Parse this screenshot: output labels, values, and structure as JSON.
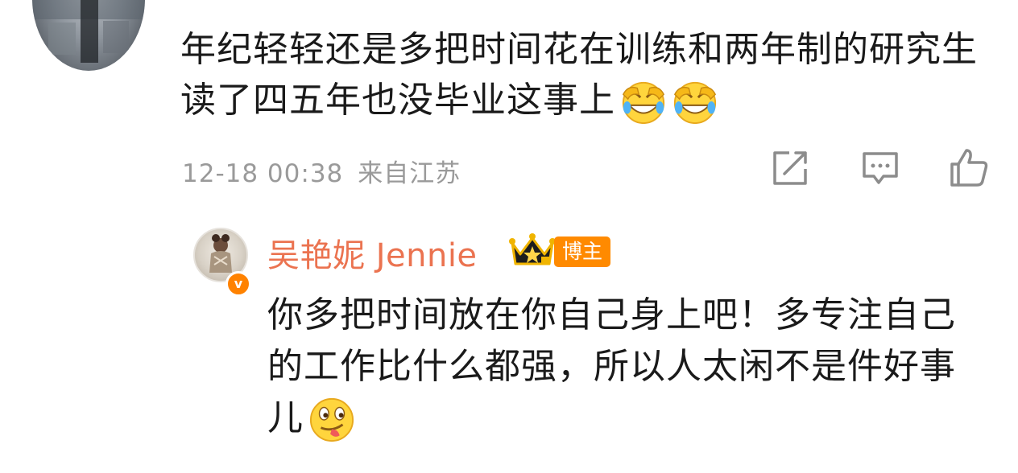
{
  "comment": {
    "text": "年纪轻轻还是多把时间花在训练和两年制的研究生读了四五年也没毕业这事上",
    "emojis": [
      "laugh-cry-icon",
      "laugh-cry-icon"
    ],
    "timestamp": "12-18 00:38",
    "location": "来自江苏",
    "actions": [
      "share-icon",
      "comment-icon",
      "like-icon"
    ]
  },
  "reply": {
    "username": "吴艳妮 Jennie",
    "author_badge": "博主",
    "text": "你多把时间放在你自己身上吧！多专注自己的工作比什么都强，所以人太闲不是件好事儿",
    "emoji": "tongue-out-icon",
    "verified_badge": "v"
  },
  "colors": {
    "username": "#eb7350",
    "badge": "#ff8a00",
    "meta": "#9a9a9a"
  }
}
